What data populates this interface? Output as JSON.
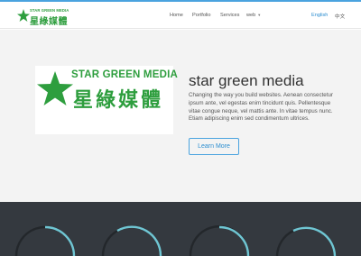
{
  "colors": {
    "accent": "#2b8dd0",
    "topbar": "#4aa3df",
    "brand_green": "#2e9e3e",
    "hero_bg": "#f3f3f3",
    "dark_bg": "#34393f",
    "ring_teal": "#6fc6d3"
  },
  "brand": {
    "logo_en": "STAR GREEN MEDIA",
    "logo_zh": "星綠媒體"
  },
  "nav": {
    "home": "Home",
    "portfolio": "Portfolio",
    "services": "Services",
    "web": "web",
    "lang_en": "English",
    "lang_zh": "中文"
  },
  "hero": {
    "title": "star green media",
    "description": "Changing the way you build websites. Aenean consectetur ipsum ante, vel egestas enim tincidunt quis. Pellentesque vitae congue neque, vel mattis ante. In vitae tempus nunc. Etiam adipiscing enim sed condimentum ultrices.",
    "button": "Learn More"
  }
}
